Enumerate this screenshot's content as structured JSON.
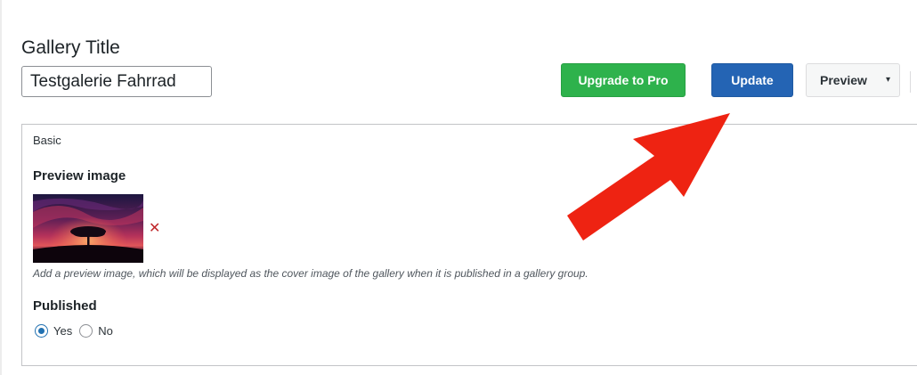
{
  "header": {
    "gallery_title_label": "Gallery Title",
    "gallery_title_value": "Testgalerie Fahrrad",
    "upgrade_label": "Upgrade to Pro",
    "update_label": "Update",
    "preview_label": "Preview",
    "preview_caret": "▾"
  },
  "panel": {
    "tab_label": "Basic",
    "preview_image_heading": "Preview image",
    "remove_icon": "✕",
    "preview_help": "Add a preview image, which will be displayed as the cover image of the gallery when it is published in a gallery group.",
    "published_heading": "Published",
    "published_options": [
      "Yes",
      "No"
    ],
    "published_selected": "Yes"
  },
  "colors": {
    "upgrade_button": "#2eb24c",
    "update_button": "#2464b4",
    "annotation_arrow": "#ee2312",
    "remove_icon": "#c0282c"
  },
  "icons": {
    "remove": "close-icon",
    "preview_dropdown": "chevron-down-icon"
  }
}
